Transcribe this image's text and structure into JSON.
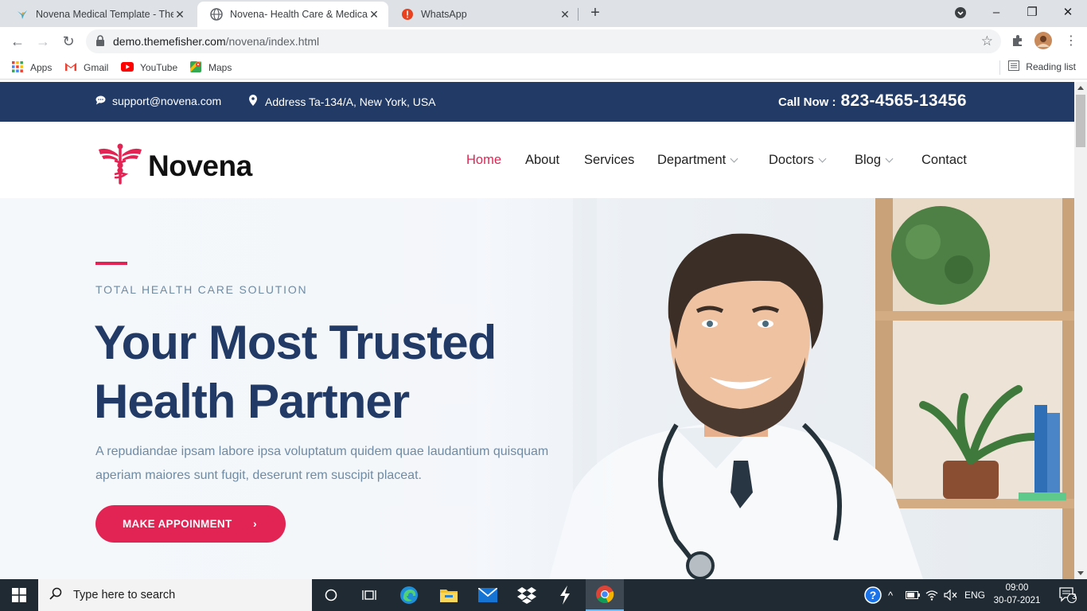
{
  "browser": {
    "tabs": [
      {
        "title": "Novena Medical Template - Themefisher",
        "active": false
      },
      {
        "title": "Novena- Health Care & Medical template",
        "active": true
      },
      {
        "title": "WhatsApp",
        "active": false
      }
    ],
    "new_tab_label": "+",
    "window_controls": {
      "minimize": "–",
      "restore": "❐",
      "close": "✕"
    },
    "url_host": "demo.themefisher.com",
    "url_path": "/novena/index.html",
    "bookmarks": [
      {
        "label": "Apps",
        "icon": "apps-grid-icon"
      },
      {
        "label": "Gmail",
        "icon": "gmail-icon"
      },
      {
        "label": "YouTube",
        "icon": "youtube-icon"
      },
      {
        "label": "Maps",
        "icon": "maps-icon"
      }
    ],
    "reading_list": "Reading list"
  },
  "site": {
    "topbar": {
      "email": "support@novena.com",
      "address": "Address Ta-134/A, New York, USA",
      "call_label": "Call Now :",
      "phone": "823-4565-13456"
    },
    "brand": "Novena",
    "menu": [
      {
        "label": "Home",
        "active": true,
        "dropdown": false
      },
      {
        "label": "About",
        "active": false,
        "dropdown": false
      },
      {
        "label": "Services",
        "active": false,
        "dropdown": false
      },
      {
        "label": "Department",
        "active": false,
        "dropdown": true
      },
      {
        "label": "Doctors",
        "active": false,
        "dropdown": true
      },
      {
        "label": "Blog",
        "active": false,
        "dropdown": true
      },
      {
        "label": "Contact",
        "active": false,
        "dropdown": false
      }
    ],
    "hero": {
      "subtitle": "TOTAL HEALTH CARE SOLUTION",
      "title_line1": "Your Most Trusted",
      "title_line2": "Health Partner",
      "text": "A repudiandae ipsam labore ipsa voluptatum quidem quae laudantium quisquam aperiam maiores sunt fugit, deserunt rem suscipit placeat.",
      "button": "MAKE APPOINMENT",
      "button_arrow": "›"
    },
    "colors": {
      "primary": "#223a66",
      "accent": "#e12454",
      "muted": "#6f8ba4"
    }
  },
  "taskbar": {
    "search_placeholder": "Type here to search",
    "language": "ENG",
    "time": "09:00",
    "date": "30-07-2021",
    "notification_count": "3"
  }
}
